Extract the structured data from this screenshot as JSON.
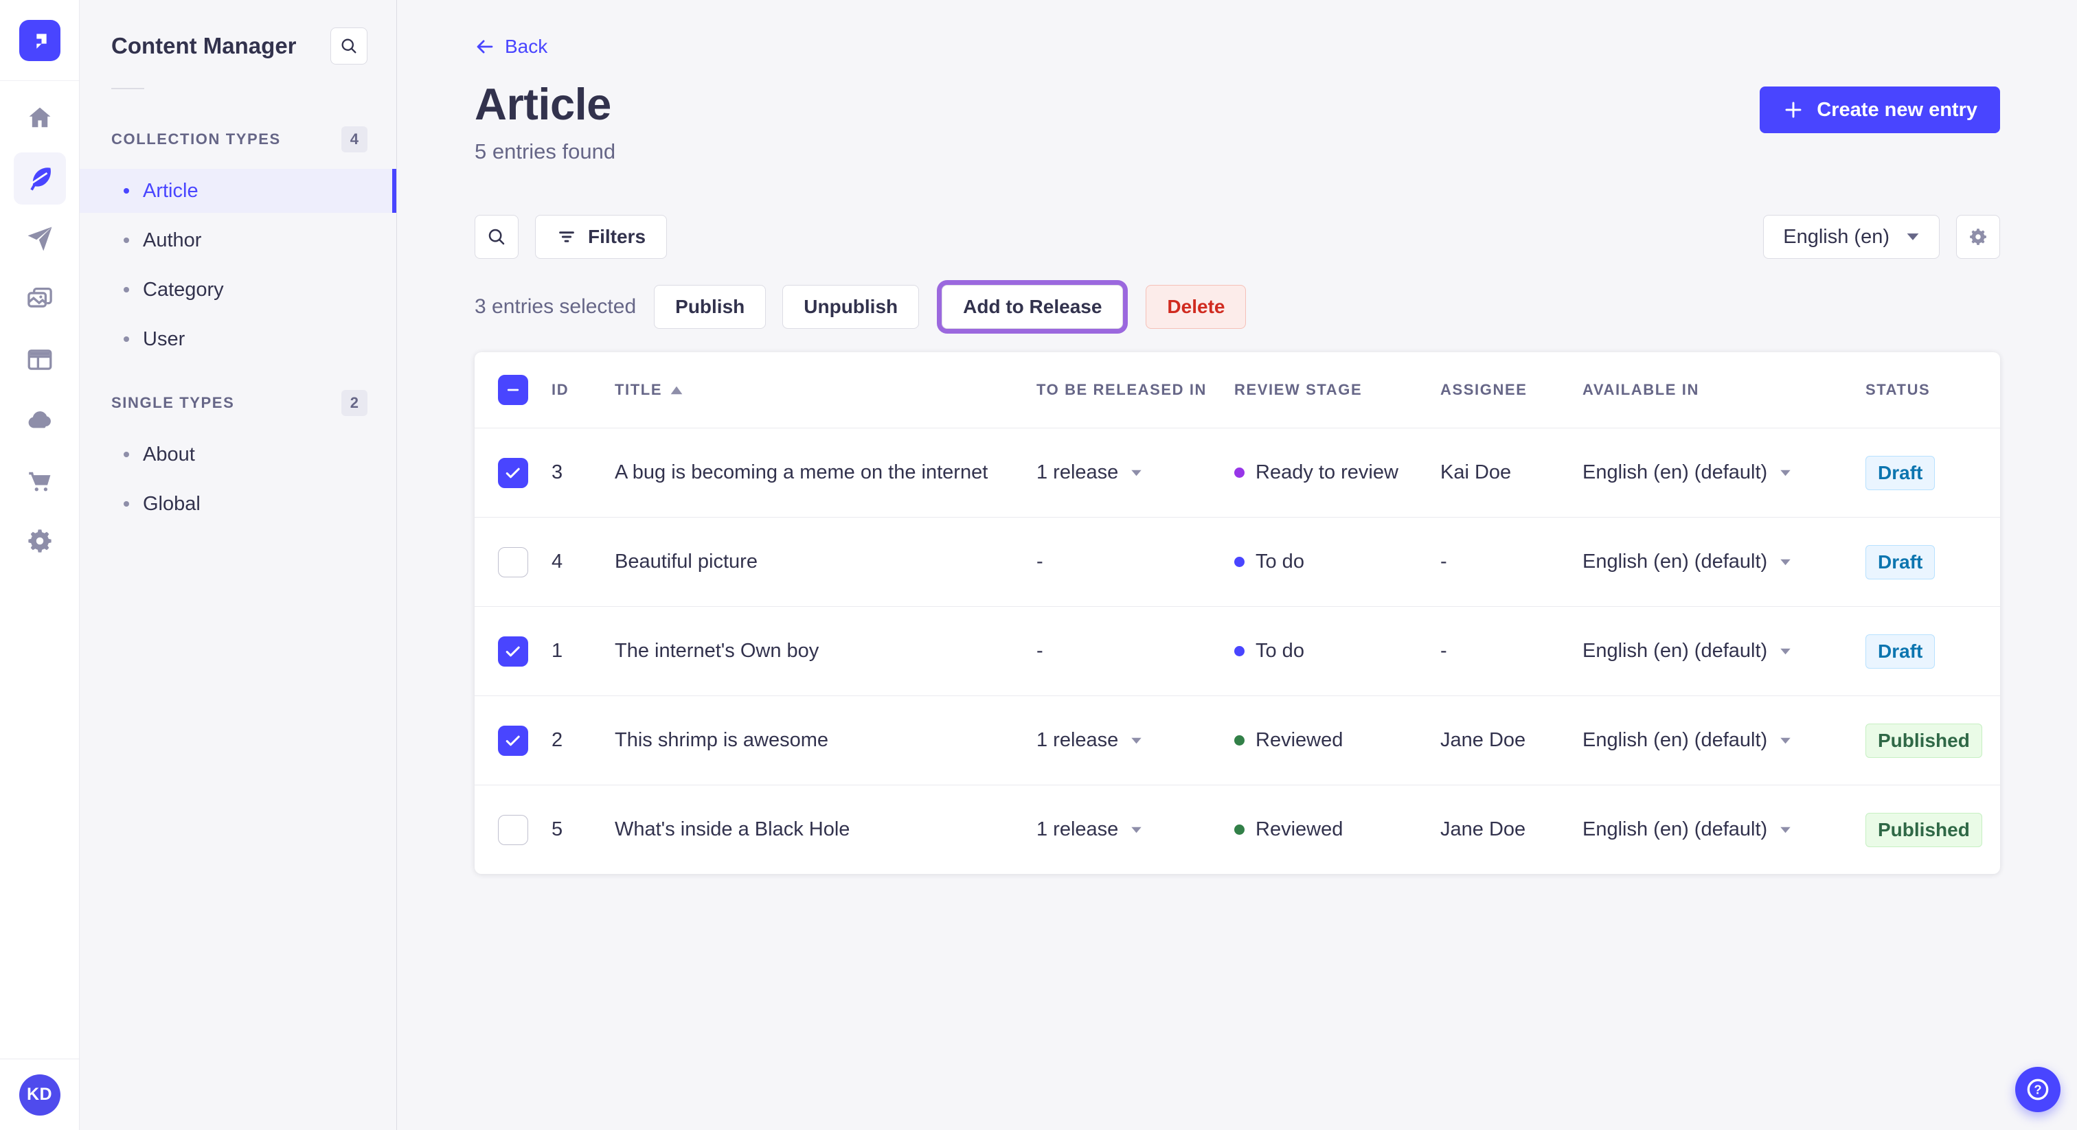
{
  "nav_rail": {
    "avatar_initials": "KD",
    "items": [
      {
        "name": "home"
      },
      {
        "name": "content-manager",
        "active": true
      },
      {
        "name": "releases"
      },
      {
        "name": "media-library"
      },
      {
        "name": "content-type-builder"
      },
      {
        "name": "deploy"
      },
      {
        "name": "marketplace"
      },
      {
        "name": "settings"
      }
    ]
  },
  "icons": {
    "strapi-logo": "blue-rounded-square-white-monogram",
    "home-icon": "house",
    "content-manager-icon": "feather",
    "releases-icon": "paper-plane",
    "media-library-icon": "pictures",
    "content-type-builder-icon": "layout-panel",
    "deploy-icon": "cloud",
    "marketplace-icon": "shopping-cart",
    "settings-icon": "gear",
    "search-icon": "magnifier",
    "filters-icon": "filter-lines",
    "back-icon": "arrow-left",
    "plus-icon": "plus",
    "sort-asc-icon": "triangle-up",
    "caret-down-icon": "triangle-down",
    "check-icon": "checkmark",
    "indeterminate-icon": "minus",
    "help-icon": "circled-question-mark"
  },
  "sidebar": {
    "title": "Content Manager",
    "sections": [
      {
        "label": "COLLECTION TYPES",
        "count": "4",
        "items": [
          {
            "label": "Article",
            "active": true
          },
          {
            "label": "Author"
          },
          {
            "label": "Category"
          },
          {
            "label": "User"
          }
        ]
      },
      {
        "label": "SINGLE TYPES",
        "count": "2",
        "items": [
          {
            "label": "About"
          },
          {
            "label": "Global"
          }
        ]
      }
    ]
  },
  "header": {
    "back_label": "Back",
    "title": "Article",
    "subtitle": "5 entries found",
    "create_button": "Create new entry"
  },
  "toolbar": {
    "filters_label": "Filters",
    "locale_value": "English (en)"
  },
  "selection_bar": {
    "selected_text": "3 entries selected",
    "publish_label": "Publish",
    "unpublish_label": "Unpublish",
    "add_to_release_label": "Add to Release",
    "delete_label": "Delete"
  },
  "colors": {
    "primary": "#4945ff",
    "active_item_bg": "#eeeefc",
    "text_dark": "#32324d",
    "text_muted": "#666687",
    "border": "#dcdce4",
    "release_highlight_ring": "#9b68de",
    "danger_text": "#d02b20",
    "danger_bg": "#fcecea",
    "danger_border": "#f5c0b8"
  },
  "table": {
    "columns": [
      {
        "label": "ID"
      },
      {
        "label": "TITLE",
        "sorted": "asc"
      },
      {
        "label": "TO BE RELEASED IN"
      },
      {
        "label": "REVIEW STAGE"
      },
      {
        "label": "ASSIGNEE"
      },
      {
        "label": "AVAILABLE IN"
      },
      {
        "label": "STATUS"
      }
    ],
    "status_styles": {
      "Draft": {
        "bg": "#eaf5ff",
        "text": "#0c75af",
        "border": "#b8e1ff"
      },
      "Published": {
        "bg": "#eafbe7",
        "text": "#2f6846",
        "border": "#c6f0c2"
      }
    },
    "rows": [
      {
        "checked": true,
        "id": "3",
        "title": "A bug is becoming a meme on the internet",
        "release": "1 release",
        "stage": "Ready to review",
        "stage_color": "#9736e8",
        "assignee": "Kai Doe",
        "available": "English (en) (default)",
        "status": "Draft"
      },
      {
        "checked": false,
        "id": "4",
        "title": "Beautiful picture",
        "release": "-",
        "stage": "To do",
        "stage_color": "#4945ff",
        "assignee": "-",
        "available": "English (en) (default)",
        "status": "Draft"
      },
      {
        "checked": true,
        "id": "1",
        "title": "The internet's Own boy",
        "release": "-",
        "stage": "To do",
        "stage_color": "#4945ff",
        "assignee": "-",
        "available": "English (en) (default)",
        "status": "Draft"
      },
      {
        "checked": true,
        "id": "2",
        "title": "This shrimp is awesome",
        "release": "1 release",
        "stage": "Reviewed",
        "stage_color": "#328048",
        "assignee": "Jane Doe",
        "available": "English (en) (default)",
        "status": "Published"
      },
      {
        "checked": false,
        "id": "5",
        "title": "What's inside a Black Hole",
        "release": "1 release",
        "stage": "Reviewed",
        "stage_color": "#328048",
        "assignee": "Jane Doe",
        "available": "English (en) (default)",
        "status": "Published"
      }
    ]
  }
}
